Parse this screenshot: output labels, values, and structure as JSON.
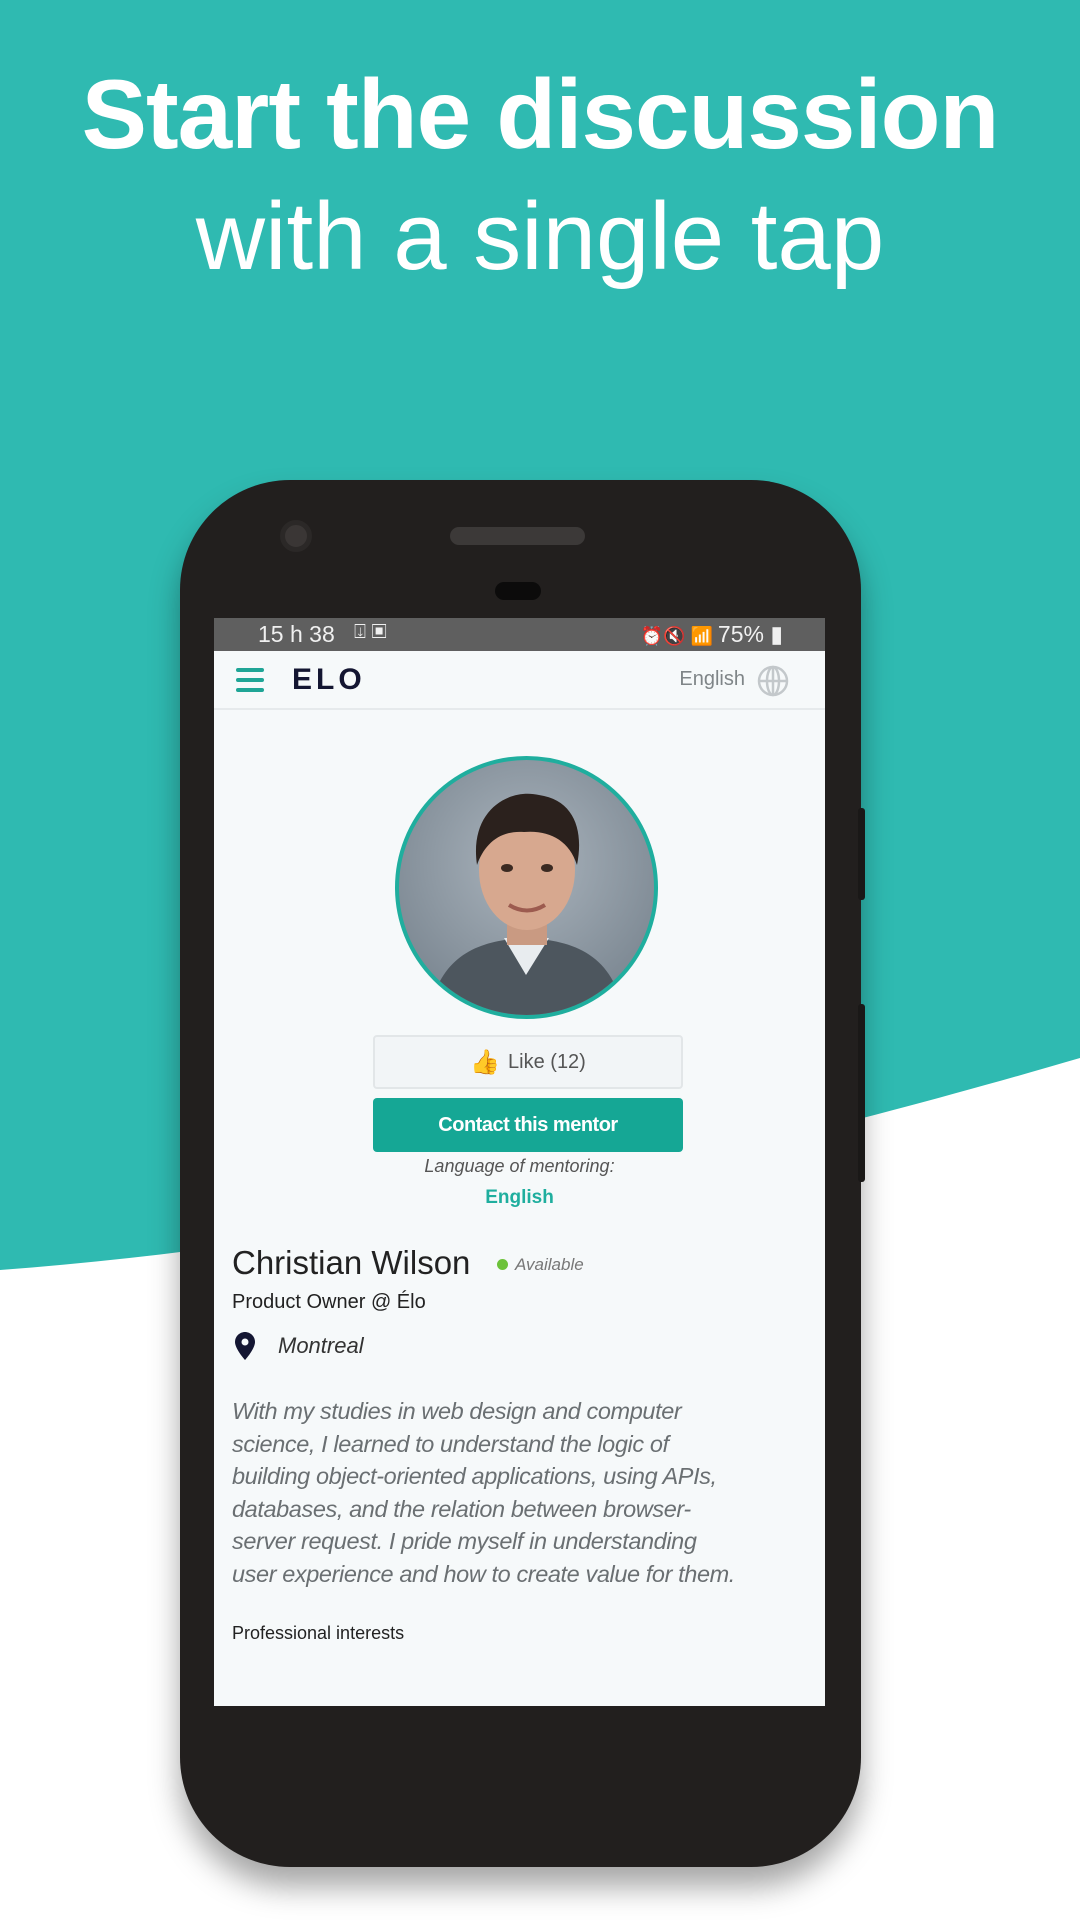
{
  "headline": {
    "line1": "Start the discussion",
    "line2": "with a single tap"
  },
  "colors": {
    "background": "#2fbab1",
    "accent": "#15a795",
    "available": "#6cc23a"
  },
  "status_bar": {
    "time": "15 h 38",
    "battery": "75%",
    "left_icons": [
      "download-icon",
      "screenshot-icon"
    ],
    "right_icons": [
      "alarm-icon",
      "mute-icon",
      "wifi-icon",
      "signal-icon",
      "battery-icon"
    ]
  },
  "app_bar": {
    "logo": "ELO",
    "language": "English"
  },
  "profile": {
    "like_label": "Like (12)",
    "contact_label": "Contact this mentor",
    "mentoring_language_label": "Language of mentoring:",
    "mentoring_language": "English",
    "name": "Christian Wilson",
    "availability": "Available",
    "role": "Product Owner @ Élo",
    "location": "Montreal",
    "bio_lines": [
      "With my studies in web design and computer",
      "science, I learned to understand the logic of",
      "building object-oriented applications, using APIs,",
      "databases, and the relation between browser-",
      "server request. I pride myself in understanding",
      "user experience and how to create value for them."
    ],
    "interests_heading": "Professional interests"
  }
}
